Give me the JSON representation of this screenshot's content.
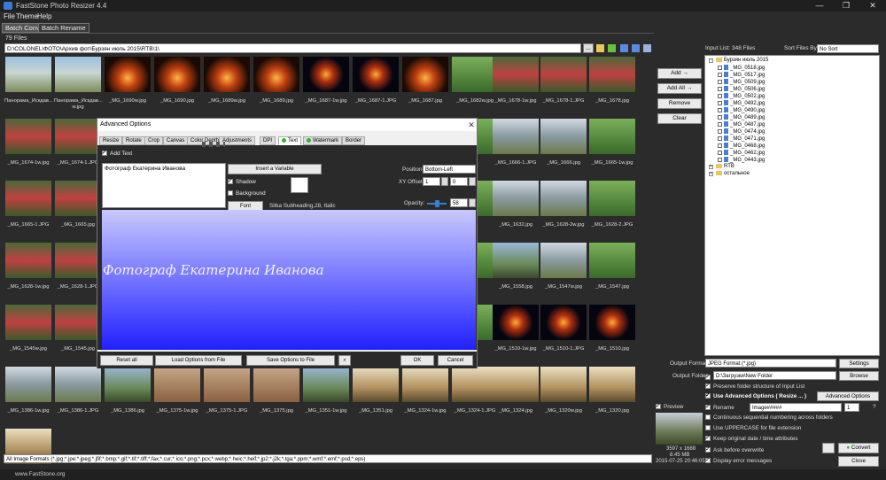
{
  "window": {
    "title": "FastStone Photo Resizer 4.4",
    "minimize": "—",
    "restore": "❐",
    "close": "✕"
  },
  "menu": [
    "File",
    "Theme",
    "Help"
  ],
  "tabs": [
    "Batch Convert",
    "Batch Rename"
  ],
  "file_count": "79 Files",
  "path": "D:\\COLONEL\\ФОТО\\Архив фот\\Бурзян июль 2015\\RTB\\1\\",
  "path_browse": "...",
  "thumbnails": [
    [
      "Панорама_Искдав...",
      "Панорама_Искдав... w.jpg",
      "_MG_1690w.jpg",
      "_MG_1690.jpg",
      "_MG_1689w.jpg",
      "_MG_1689.jpg",
      "_MG_1687-1w.jpg",
      "_MG_1687-1.JPG",
      "_MG_1687.jpg",
      "_MG_1682w.jpg",
      "_MG_1678-1w.jpg",
      "_MG_1678-1.JPG",
      "_MG_1678.jpg"
    ],
    [
      "_MG_1674-1w.jpg",
      "_MG_1674-1.JPG",
      "",
      "",
      "",
      "",
      "",
      "",
      "",
      "",
      "_MG_1666-1.JPG",
      "_MG_1666.jpg",
      "_MG_1665-1w.jpg"
    ],
    [
      "_MG_1665-1.JPG",
      "_MG_1665.jpg",
      "",
      "",
      "",
      "",
      "",
      "",
      "",
      "",
      "_MG_1632.jpg",
      "_MG_1628-2w.jpg",
      "_MG_1628-2.JPG"
    ],
    [
      "_MG_1628-1w.jpg",
      "_MG_1628-1.JPG",
      "",
      "",
      "",
      "",
      "",
      "",
      "",
      "",
      "_MG_1558.jpg",
      "_MG_1547w.jpg",
      "_MG_1547.jpg"
    ],
    [
      "_MG_1545w.jpg",
      "_MG_1545.jpg",
      "",
      "",
      "",
      "",
      "",
      "",
      "",
      "",
      "_MG_1510-1w.jpg",
      "_MG_1510-1.JPG",
      "_MG_1510.jpg"
    ],
    [
      "_MG_1386-1w.jpg",
      "_MG_1386-1.JPG",
      "_MG_1386.jpg",
      "_MG_1375-1w.jpg",
      "_MG_1375-1.JPG",
      "_MG_1375.jpg",
      "_MG_1351-1w.jpg",
      "_MG_1351.jpg",
      "_MG_1324-1w.jpg",
      "_MG_1324-1.JPG",
      "_MG_1324.jpg",
      "_MG_1320w.jpg",
      "_MG_1320.jpg"
    ],
    [
      "",
      "",
      "",
      "",
      "",
      "",
      "",
      "",
      "",
      "",
      "",
      "",
      ""
    ]
  ],
  "filter": "All Image Formats (*.jpg;*.jpe;*.jpeg;*.jfif;*.bmp;*.gif;*.tif;*.tiff;*.fax;*.cur;*.ico;*.png;*.pcx;*.webp;*.heic;*.heif;*.jp2;*.j2k;*.tga;*.ppm;*.wmf;*.emf;*.psd;*.eps)",
  "status_url": "www.FastStone.org",
  "actions": {
    "add": "Add →",
    "add_all": "Add All →",
    "remove": "Remove",
    "clear": "Clear"
  },
  "input_list": {
    "label": "Input List:  348 Files",
    "sort_label": "Sort Files By:",
    "sort_value": "No Sort",
    "root": "Бурзян июль 2015",
    "files": [
      "_MG_0518.jpg",
      "_MG_0517.jpg",
      "_MG_0509.jpg",
      "_MG_0506.jpg",
      "_MG_0502.jpg",
      "_MG_0492.jpg",
      "_MG_0490.jpg",
      "_MG_0489.jpg",
      "_MG_0487.jpg",
      "_MG_0474.jpg",
      "_MG_0471.jpg",
      "_MG_0468.jpg",
      "_MG_0462.jpg",
      "_MG_0443.jpg"
    ],
    "folders": [
      "RTB",
      "остальное"
    ]
  },
  "output": {
    "format_label": "Output Format:",
    "format_value": "JPEG Format (*.jpg)",
    "settings": "Settings",
    "folder_label": "Output Folder:",
    "folder_value": "D:\\Загрузки\\New Folder",
    "browse": "Browse",
    "preserve": "Preserve folder structure of Input List",
    "advanced_label": "Use Advanced Options ( Resize ... )",
    "advanced_button": "Advanced Options",
    "rename": "Rename",
    "rename_pattern": "Image#####",
    "rename_start": "1",
    "rename_help": "?",
    "continuous": "Continuous sequential numbering across folders",
    "uppercase": "Use UPPERCASE for file extension",
    "keep_date": "Keep original date / time attributes",
    "ask_overwrite": "Ask before overwrite",
    "display_errors": "Display error messages",
    "convert": "Convert",
    "close": "Close",
    "preview_label": "Preview",
    "preview_dims": "3597 x 1688",
    "preview_size": "8.45 MB",
    "preview_date": "2015-07-25 20:46:05"
  },
  "dialog": {
    "title": "Advanced Options",
    "close": "✕",
    "tabs": [
      "Resize",
      "Rotate",
      "Crop",
      "Canvas",
      "Color Depth",
      "Adjustments",
      "DPI",
      "Text",
      "Watermark",
      "Border"
    ],
    "add_text_label": "Add Text",
    "text_value": "Фотограф Екатерина Иванова",
    "insert_variable": "Insert a Variable",
    "shadow": "Shadow",
    "background": "Background",
    "font_button": "Font",
    "font_desc": "Sitka Subheading,28, Italic",
    "position_label": "Position:",
    "position_value": "Bottom-Left",
    "xy_label": "XY Offset:",
    "x_offset": "1",
    "y_offset": "0",
    "opacity_label": "Opacity:",
    "opacity_value": "58",
    "preview_text": "Фотограф Екатерина Иванова",
    "reset_all": "Reset all",
    "load": "Load Options from File",
    "save": "Save Options to File",
    "ok": "OK",
    "cancel": "Cancel"
  },
  "colors": {
    "accent": "#34b234",
    "preview_top": "#c8c8ff",
    "preview_bottom": "#2020ff"
  }
}
